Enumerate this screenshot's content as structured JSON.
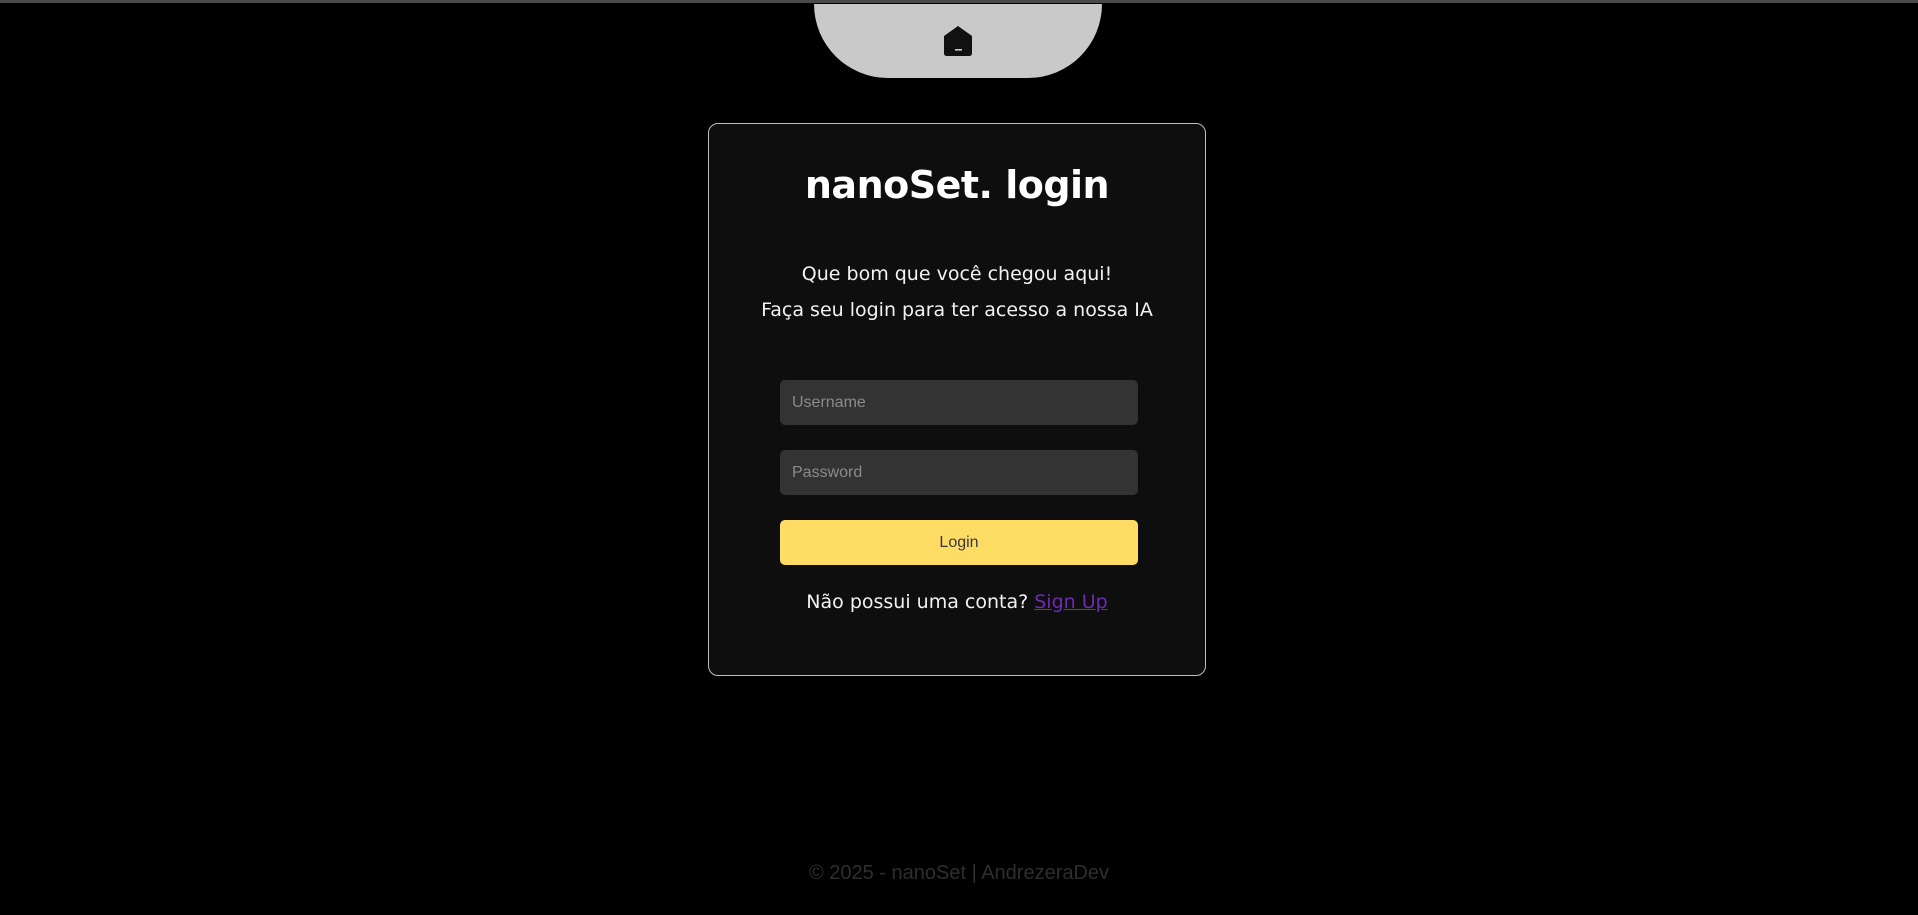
{
  "nav": {
    "home_icon": "home-icon",
    "tab_color": "#c9c9c9"
  },
  "login_card": {
    "title": "nanoSet. login",
    "greeting_line1": "Que bom que você chegou aqui!",
    "greeting_line2": "Faça seu login para ter acesso a nossa IA",
    "username": {
      "value": "",
      "placeholder": "Username"
    },
    "password": {
      "value": "",
      "placeholder": "Password"
    },
    "login_label": "Login",
    "signup_prompt": "Não possui uma conta?",
    "signup_link": "Sign Up"
  },
  "footer": {
    "text": "© 2025 - nanoSet | AndrezeraDev"
  },
  "colors": {
    "background": "#000000",
    "card": "#0e0e0e",
    "accent": "#ffdc64",
    "link": "#6d2bb3",
    "input": "#333333"
  }
}
